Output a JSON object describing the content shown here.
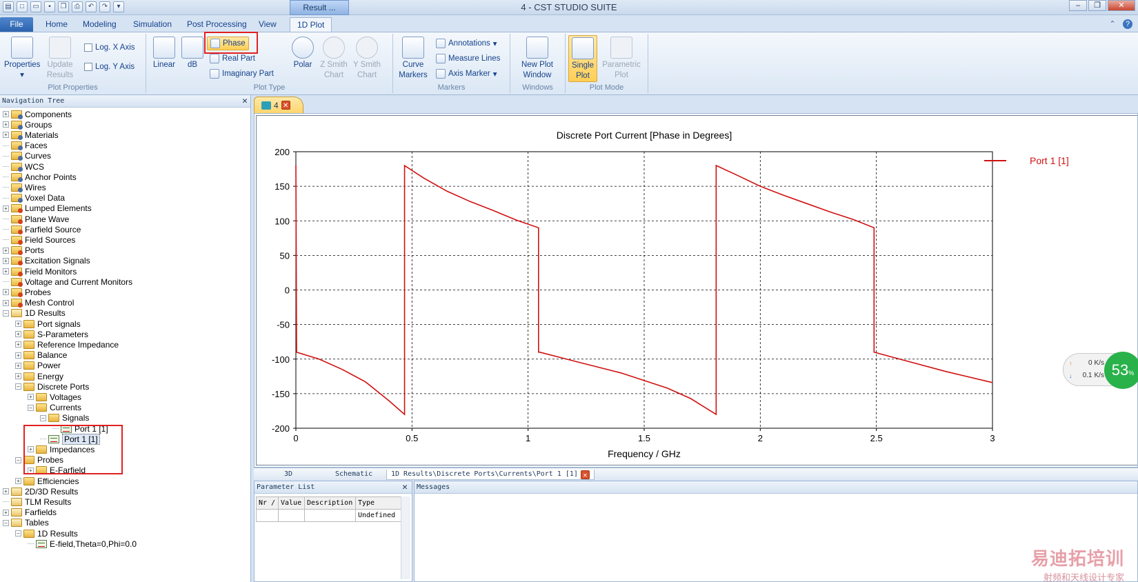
{
  "window": {
    "title": "4 - CST STUDIO SUITE",
    "context_tab": "Result ..."
  },
  "ribbon_tabs": [
    "File",
    "Home",
    "Modeling",
    "Simulation",
    "Post Processing",
    "View",
    "1D Plot"
  ],
  "ribbon": {
    "plot_properties": {
      "properties_label": "Properties",
      "update_results_label": "Update Results",
      "log_x": "Log. X Axis",
      "log_y": "Log. Y Axis",
      "group_label": "Plot Properties"
    },
    "plot_type": {
      "linear": "Linear",
      "db": "dB",
      "phase": "Phase",
      "real_part": "Real Part",
      "imaginary_part": "Imaginary Part",
      "polar": "Polar",
      "z_smith": "Z Smith Chart",
      "y_smith": "Y Smith Chart",
      "group_label": "Plot Type"
    },
    "markers": {
      "curve_markers": "Curve Markers",
      "annotations": "Annotations",
      "measure_lines": "Measure Lines",
      "axis_marker": "Axis Marker",
      "group_label": "Markers"
    },
    "windows": {
      "new_plot_window": "New Plot Window",
      "group_label": "Windows"
    },
    "plot_mode": {
      "single_plot": "Single Plot",
      "parametric_plot": "Parametric Plot",
      "group_label": "Plot Mode"
    }
  },
  "nav": {
    "header": "Navigation Tree",
    "items": [
      {
        "label": "Components",
        "level": 0,
        "exp": "+",
        "icon": "folder-gear"
      },
      {
        "label": "Groups",
        "level": 0,
        "exp": "+",
        "icon": "folder-gear"
      },
      {
        "label": "Materials",
        "level": 0,
        "exp": "+",
        "icon": "folder-gear"
      },
      {
        "label": "Faces",
        "level": 0,
        "exp": "",
        "icon": "folder-gear"
      },
      {
        "label": "Curves",
        "level": 0,
        "exp": "",
        "icon": "folder-gear"
      },
      {
        "label": "WCS",
        "level": 0,
        "exp": "",
        "icon": "folder-gear"
      },
      {
        "label": "Anchor Points",
        "level": 0,
        "exp": "",
        "icon": "folder-gear"
      },
      {
        "label": "Wires",
        "level": 0,
        "exp": "",
        "icon": "folder-gear"
      },
      {
        "label": "Voxel Data",
        "level": 0,
        "exp": "",
        "icon": "folder-gear"
      },
      {
        "label": "Lumped Elements",
        "level": 0,
        "exp": "+",
        "icon": "folder-fire"
      },
      {
        "label": "Plane Wave",
        "level": 0,
        "exp": "",
        "icon": "folder-fire"
      },
      {
        "label": "Farfield Source",
        "level": 0,
        "exp": "",
        "icon": "folder-fire"
      },
      {
        "label": "Field Sources",
        "level": 0,
        "exp": "",
        "icon": "folder-fire"
      },
      {
        "label": "Ports",
        "level": 0,
        "exp": "+",
        "icon": "folder-fire"
      },
      {
        "label": "Excitation Signals",
        "level": 0,
        "exp": "+",
        "icon": "folder-fire"
      },
      {
        "label": "Field Monitors",
        "level": 0,
        "exp": "+",
        "icon": "folder-fire"
      },
      {
        "label": "Voltage and Current Monitors",
        "level": 0,
        "exp": "",
        "icon": "folder-fire"
      },
      {
        "label": "Probes",
        "level": 0,
        "exp": "+",
        "icon": "folder-fire"
      },
      {
        "label": "Mesh Control",
        "level": 0,
        "exp": "+",
        "icon": "folder-fire"
      },
      {
        "label": "1D Results",
        "level": 0,
        "exp": "-",
        "icon": "folder-stack"
      },
      {
        "label": "Port signals",
        "level": 1,
        "exp": "+",
        "icon": "folder"
      },
      {
        "label": "S-Parameters",
        "level": 1,
        "exp": "+",
        "icon": "folder"
      },
      {
        "label": "Reference Impedance",
        "level": 1,
        "exp": "+",
        "icon": "folder"
      },
      {
        "label": "Balance",
        "level": 1,
        "exp": "+",
        "icon": "folder"
      },
      {
        "label": "Power",
        "level": 1,
        "exp": "+",
        "icon": "folder"
      },
      {
        "label": "Energy",
        "level": 1,
        "exp": "+",
        "icon": "folder"
      },
      {
        "label": "Discrete Ports",
        "level": 1,
        "exp": "-",
        "icon": "folder"
      },
      {
        "label": "Voltages",
        "level": 2,
        "exp": "+",
        "icon": "folder"
      },
      {
        "label": "Currents",
        "level": 2,
        "exp": "-",
        "icon": "folder"
      },
      {
        "label": "Signals",
        "level": 3,
        "exp": "-",
        "icon": "folder"
      },
      {
        "label": "Port 1 [1]",
        "level": 4,
        "exp": "",
        "icon": "plot"
      },
      {
        "label": "Port 1 [1]",
        "level": 3,
        "exp": "",
        "icon": "plot",
        "selected": true
      },
      {
        "label": "Impedances",
        "level": 2,
        "exp": "+",
        "icon": "folder"
      },
      {
        "label": "Probes",
        "level": 1,
        "exp": "-",
        "icon": "folder"
      },
      {
        "label": "E-Farfield",
        "level": 2,
        "exp": "+",
        "icon": "folder"
      },
      {
        "label": "Efficiencies",
        "level": 1,
        "exp": "+",
        "icon": "folder"
      },
      {
        "label": "2D/3D Results",
        "level": 0,
        "exp": "+",
        "icon": "folder-stack"
      },
      {
        "label": "TLM Results",
        "level": 0,
        "exp": "",
        "icon": "folder-stack"
      },
      {
        "label": "Farfields",
        "level": 0,
        "exp": "+",
        "icon": "folder-stack"
      },
      {
        "label": "Tables",
        "level": 0,
        "exp": "-",
        "icon": "folder-stack"
      },
      {
        "label": "1D Results",
        "level": 1,
        "exp": "-",
        "icon": "folder"
      },
      {
        "label": "E-field,Theta=0,Phi=0.0",
        "level": 2,
        "exp": "",
        "icon": "plot"
      }
    ]
  },
  "doc_tab": {
    "label": "4"
  },
  "view_tabs": [
    "3D",
    "Schematic",
    "1D Results\\Discrete Ports\\Currents\\Port 1 [1]"
  ],
  "parameter_list": {
    "header": "Parameter List",
    "columns": [
      "Nr /",
      "Value",
      "Description",
      "Type"
    ],
    "rows": [
      [
        "",
        "",
        "",
        "Undefined"
      ]
    ]
  },
  "messages": {
    "header": "Messages"
  },
  "net_widget": {
    "up": "0",
    "down": "0.1",
    "unit": "K/s",
    "percent": "53",
    "pct_sign": "%"
  },
  "watermark": {
    "main": "易迪拓培训",
    "sub": "射频和天线设计专家"
  },
  "colors": {
    "curve": "#d01010",
    "accent": "#ffcf55",
    "highlight_box": "#e02020"
  },
  "chart_data": {
    "type": "line",
    "title": "Discrete Port Current [Phase in Degrees]",
    "xlabel": "Frequency / GHz",
    "ylabel": "",
    "xlim": [
      0,
      3
    ],
    "ylim": [
      -200,
      200
    ],
    "xticks": [
      0,
      0.5,
      1,
      1.5,
      2,
      2.5,
      3
    ],
    "yticks": [
      -200,
      -150,
      -100,
      -50,
      0,
      50,
      100,
      150,
      200
    ],
    "grid": true,
    "legend_position": "right",
    "series": [
      {
        "name": "Port 1 [1]",
        "color": "#d01010",
        "x": [
          0.0,
          0.003,
          0.003,
          0.1,
          0.2,
          0.3,
          0.4,
          0.468,
          0.468,
          0.55,
          0.65,
          0.75,
          0.85,
          0.95,
          1.045,
          1.045,
          1.05,
          1.2,
          1.4,
          1.6,
          1.7,
          1.81,
          1.81,
          1.9,
          2.0,
          2.1,
          2.2,
          2.3,
          2.4,
          2.49,
          2.49,
          2.6,
          2.8,
          3.0
        ],
        "y": [
          180,
          -90,
          -90,
          -100,
          -115,
          -133,
          -160,
          -180,
          180,
          162,
          143,
          128,
          115,
          101,
          90,
          -90,
          -90,
          -103,
          -120,
          -142,
          -157,
          -180,
          180,
          166,
          150,
          137,
          125,
          113,
          102,
          90,
          -90,
          -100,
          -118,
          -134
        ]
      }
    ]
  }
}
